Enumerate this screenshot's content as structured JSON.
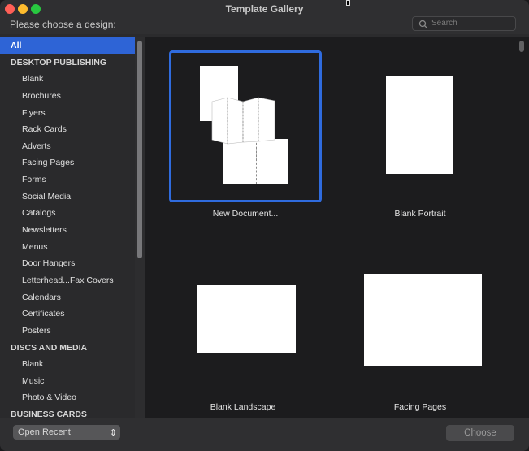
{
  "window": {
    "title": "Template Gallery"
  },
  "header": {
    "prompt": "Please choose a design:",
    "search_placeholder": "Search"
  },
  "sidebar": {
    "items": [
      {
        "label": "All",
        "kind": "selected"
      },
      {
        "label": "DESKTOP PUBLISHING",
        "kind": "category"
      },
      {
        "label": "Blank",
        "kind": "item"
      },
      {
        "label": "Brochures",
        "kind": "item"
      },
      {
        "label": "Flyers",
        "kind": "item"
      },
      {
        "label": "Rack Cards",
        "kind": "item"
      },
      {
        "label": "Adverts",
        "kind": "item"
      },
      {
        "label": "Facing Pages",
        "kind": "item"
      },
      {
        "label": "Forms",
        "kind": "item"
      },
      {
        "label": "Social Media",
        "kind": "item"
      },
      {
        "label": "Catalogs",
        "kind": "item"
      },
      {
        "label": "Newsletters",
        "kind": "item"
      },
      {
        "label": "Menus",
        "kind": "item"
      },
      {
        "label": "Door Hangers",
        "kind": "item"
      },
      {
        "label": "Letterhead...Fax Covers",
        "kind": "item"
      },
      {
        "label": "Calendars",
        "kind": "item"
      },
      {
        "label": "Certificates",
        "kind": "item"
      },
      {
        "label": "Posters",
        "kind": "item"
      },
      {
        "label": "DISCS AND MEDIA",
        "kind": "category"
      },
      {
        "label": "Blank",
        "kind": "item"
      },
      {
        "label": "Music",
        "kind": "item"
      },
      {
        "label": "Photo & Video",
        "kind": "item"
      },
      {
        "label": "BUSINESS CARDS",
        "kind": "category"
      }
    ]
  },
  "gallery": {
    "tiles": [
      {
        "label": "New Document...",
        "selected": true
      },
      {
        "label": "Blank Portrait",
        "selected": false
      },
      {
        "label": "Blank Landscape",
        "selected": false
      },
      {
        "label": "Facing Pages",
        "selected": false
      }
    ]
  },
  "footer": {
    "open_recent_label": "Open Recent",
    "choose_label": "Choose"
  },
  "colors": {
    "accent": "#2e64d6",
    "selection_border": "#2f6bde"
  }
}
